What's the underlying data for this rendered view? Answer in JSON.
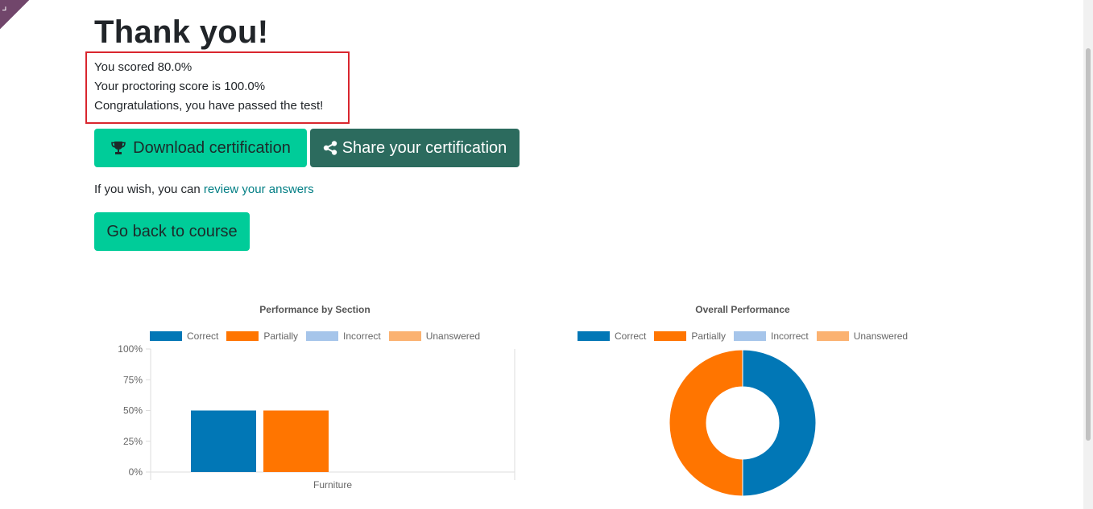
{
  "heading": "Thank you!",
  "results": {
    "score_line": "You scored 80.0%",
    "proctoring_line": "Your proctoring score is 100.0%",
    "passed_line": "Congratulations, you have passed the test!"
  },
  "buttons": {
    "download": "Download certification",
    "share": "Share your certification",
    "back": "Go back to course"
  },
  "review": {
    "prefix": "If you wish, you can ",
    "link": "review your answers"
  },
  "colors": {
    "correct": "#0177b6",
    "partially": "#ff7500",
    "incorrect": "#a6c5ea",
    "unanswered": "#fbb271",
    "primary": "#00cc99",
    "share": "#2c6b5e"
  },
  "icons": {
    "download": "trophy-icon",
    "share": "share-icon"
  },
  "chart_data": [
    {
      "type": "bar",
      "title": "Performance by Section",
      "categories": [
        "Furniture"
      ],
      "series": [
        {
          "name": "Correct",
          "values": [
            50
          ]
        },
        {
          "name": "Partially",
          "values": [
            50
          ]
        },
        {
          "name": "Incorrect",
          "values": [
            0
          ]
        },
        {
          "name": "Unanswered",
          "values": [
            0
          ]
        }
      ],
      "yticks": [
        "0%",
        "25%",
        "50%",
        "75%",
        "100%"
      ],
      "ylim": [
        0,
        100
      ],
      "legend": "top"
    },
    {
      "type": "pie",
      "title": "Overall Performance",
      "labels": [
        "Correct",
        "Partially",
        "Incorrect",
        "Unanswered"
      ],
      "values": [
        50,
        50,
        0,
        0
      ],
      "legend": "top"
    }
  ]
}
